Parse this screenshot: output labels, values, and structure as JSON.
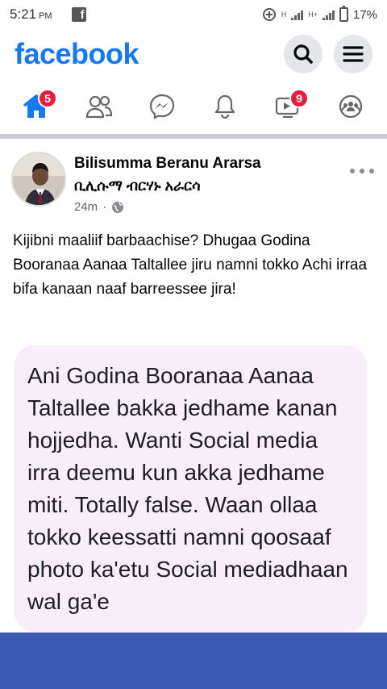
{
  "status_bar": {
    "time": "5:21",
    "ampm": "PM",
    "network_label": "H+",
    "battery": "17%"
  },
  "header": {
    "brand": "facebook"
  },
  "nav": {
    "home_badge": "5",
    "watch_badge": "9"
  },
  "post": {
    "author": "Bilisumma Beranu Ararsa",
    "author_alt": "ቢሊሱማ ብርሃኑ አራርሳ",
    "time": "24m",
    "separator": "·",
    "text": "Kijibni maaliif barbaachise? Dhugaa Godina Booranaa Aanaa Taltallee jiru namni tokko Achi irraa bifa kanaan naaf barreessee jira!",
    "quote_text": "Ani Godina Booranaa Aanaa Taltallee bakka jedhame kanan hojjedha. Wanti Social media irra deemu kun akka jedhame miti. Totally false. Waan ollaa tokko keessatti namni qoosaaf photo ka'etu Social mediadhaan wal ga'e"
  },
  "colors": {
    "brand": "#1877f2",
    "badge": "#e41e3f",
    "quote_bg": "#f7eef9",
    "bottom_bar": "#3b5bb3"
  }
}
